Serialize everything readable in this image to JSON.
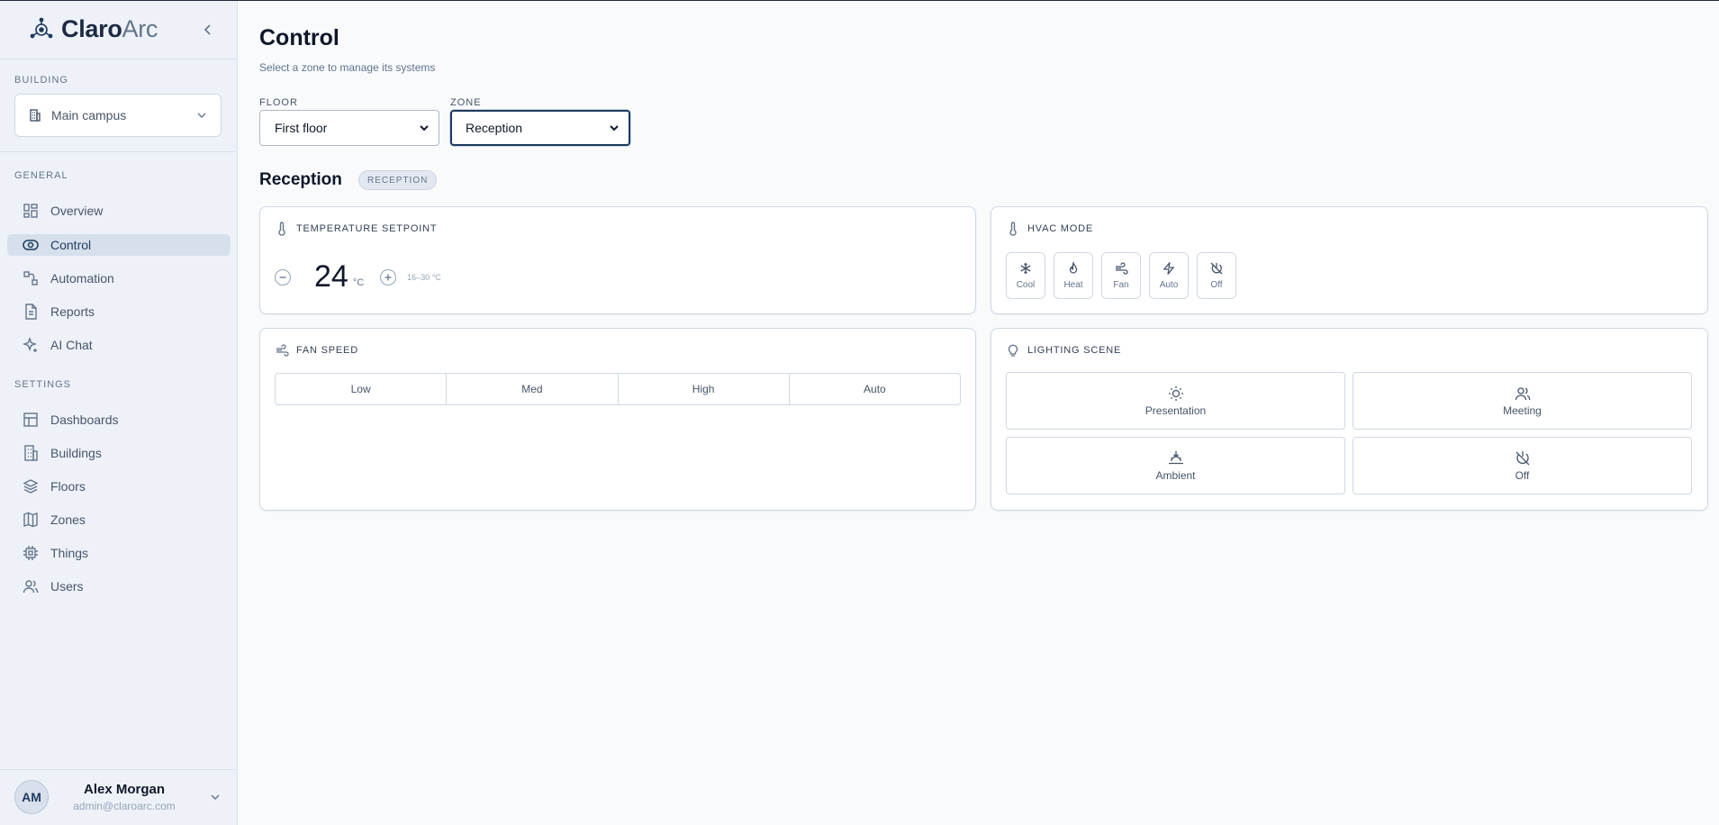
{
  "brand": {
    "name_strong": "Claro",
    "name_light": "Arc"
  },
  "sidebar": {
    "building_label": "BUILDING",
    "building_value": "Main campus",
    "general_label": "GENERAL",
    "settings_label": "SETTINGS",
    "general_items": [
      {
        "label": "Overview",
        "icon": "grid-icon"
      },
      {
        "label": "Control",
        "icon": "eye-icon",
        "active": true
      },
      {
        "label": "Automation",
        "icon": "workflow-icon"
      },
      {
        "label": "Reports",
        "icon": "file-icon"
      },
      {
        "label": "AI Chat",
        "icon": "sparkles-icon"
      }
    ],
    "settings_items": [
      {
        "label": "Dashboards",
        "icon": "dashboard-icon"
      },
      {
        "label": "Buildings",
        "icon": "building-icon"
      },
      {
        "label": "Floors",
        "icon": "layers-icon"
      },
      {
        "label": "Zones",
        "icon": "map-icon"
      },
      {
        "label": "Things",
        "icon": "chip-icon"
      },
      {
        "label": "Users",
        "icon": "users-icon"
      }
    ],
    "user": {
      "initials": "AM",
      "name": "Alex Morgan",
      "email": "admin@claroarc.com"
    }
  },
  "main": {
    "title": "Control",
    "subtitle": "Select a zone to manage its systems",
    "floor_label": "FLOOR",
    "floor_value": "First floor",
    "zone_label": "ZONE",
    "zone_value": "Reception",
    "zone_title": "Reception",
    "zone_badge": "RECEPTION"
  },
  "temperature": {
    "title": "TEMPERATURE SETPOINT",
    "value": "24",
    "unit": "°C",
    "range": "16–30 °C"
  },
  "hvac": {
    "title": "HVAC MODE",
    "modes": [
      "Cool",
      "Heat",
      "Fan",
      "Auto",
      "Off"
    ]
  },
  "fan": {
    "title": "FAN SPEED",
    "options": [
      "Low",
      "Med",
      "High",
      "Auto"
    ]
  },
  "lighting": {
    "title": "LIGHTING SCENE",
    "scenes": [
      "Presentation",
      "Meeting",
      "Ambient",
      "Off"
    ]
  },
  "colors": {
    "accent": "#1e3a5f",
    "active_nav_bg": "#d6e0ec",
    "background": "#f8fafc"
  }
}
